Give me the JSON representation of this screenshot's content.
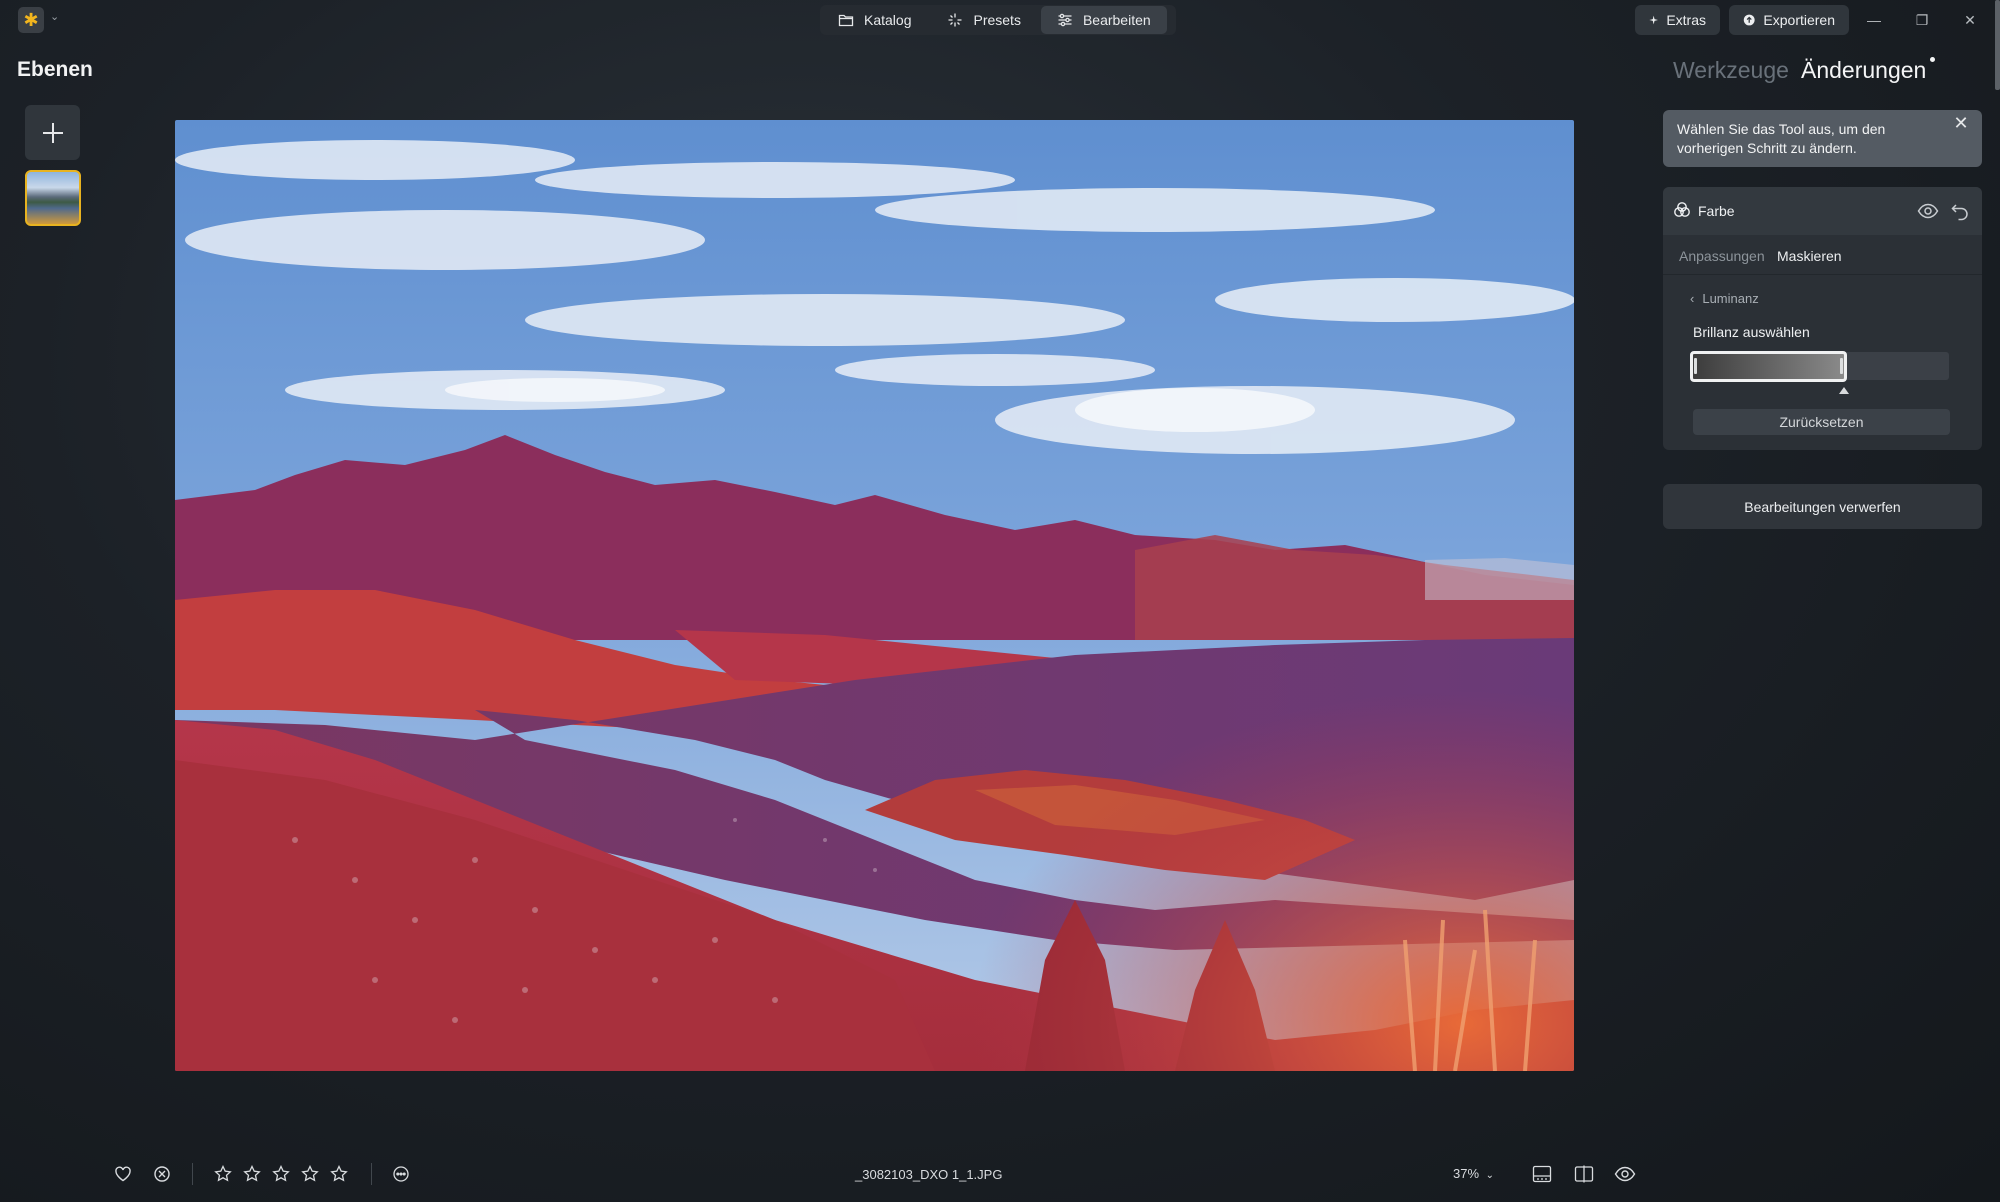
{
  "topbar": {
    "modes": [
      {
        "label": "Katalog",
        "icon": "folder-icon"
      },
      {
        "label": "Presets",
        "icon": "sparkle-icon"
      },
      {
        "label": "Bearbeiten",
        "icon": "sliders-icon",
        "active": true
      }
    ],
    "extras_label": "Extras",
    "export_label": "Exportieren"
  },
  "left_panel": {
    "title": "Ebenen"
  },
  "right_panel": {
    "tabs": [
      "Werkzeuge",
      "Änderungen"
    ],
    "active_tab": "Änderungen",
    "tooltip": "Wählen Sie das Tool aus, um den vorherigen Schritt zu ändern.",
    "tool": {
      "name": "Farbe",
      "subtabs": [
        "Anpassungen",
        "Maskieren"
      ],
      "active_subtab": "Maskieren",
      "back_label": "Luminanz",
      "slider_label": "Brillanz auswählen",
      "reset_label": "Zurücksetzen"
    },
    "discard_label": "Bearbeitungen verwerfen"
  },
  "bottom_bar": {
    "filename": "_3082103_DXO 1_1.JPG",
    "zoom": "37%",
    "rating_stars": 5,
    "rating": 0
  },
  "colors": {
    "accent_yellow": "#e8b320",
    "panel_bg": "#2b3036"
  }
}
